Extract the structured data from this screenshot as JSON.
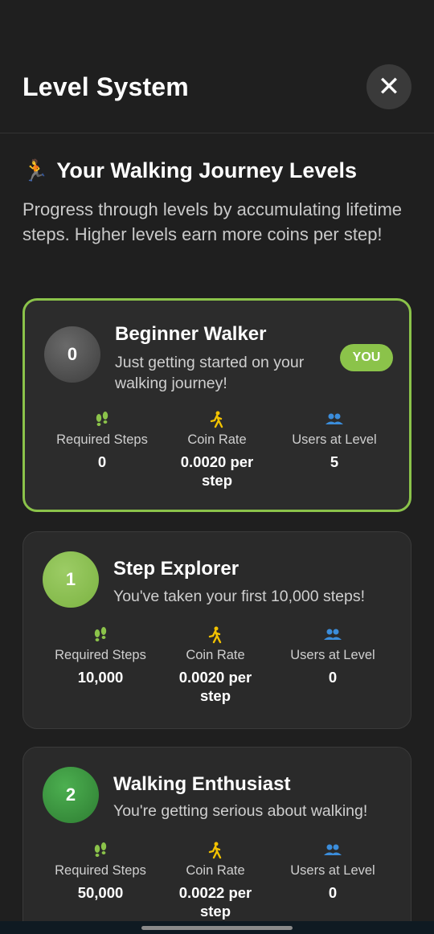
{
  "header": {
    "title": "Level System",
    "close_label": "✕"
  },
  "section": {
    "emoji": "🏃",
    "title": "Your Walking Journey Levels",
    "description": "Progress through levels by accumulating lifetime steps. Higher levels earn more coins per step!"
  },
  "labels": {
    "required_steps": "Required Steps",
    "coin_rate": "Coin Rate",
    "users_at_level": "Users at Level"
  },
  "levels": [
    {
      "number": "0",
      "name": "Beginner Walker",
      "description": "Just getting started on your walking journey!",
      "badge": "YOU",
      "required_steps": "0",
      "coin_rate": "0.0020 per step",
      "users": "5"
    },
    {
      "number": "1",
      "name": "Step Explorer",
      "description": "You've taken your first 10,000 steps!",
      "required_steps": "10,000",
      "coin_rate": "0.0020 per step",
      "users": "0"
    },
    {
      "number": "2",
      "name": "Walking Enthusiast",
      "description": "You're getting serious about walking!",
      "required_steps": "50,000",
      "coin_rate": "0.0022 per step",
      "users": "0"
    }
  ],
  "colors": {
    "accent": "#8bc34a",
    "icon_steps": "#8bc34a",
    "icon_coin": "#f2c200",
    "icon_users": "#3b8ddb",
    "background": "#1f1f1f"
  }
}
